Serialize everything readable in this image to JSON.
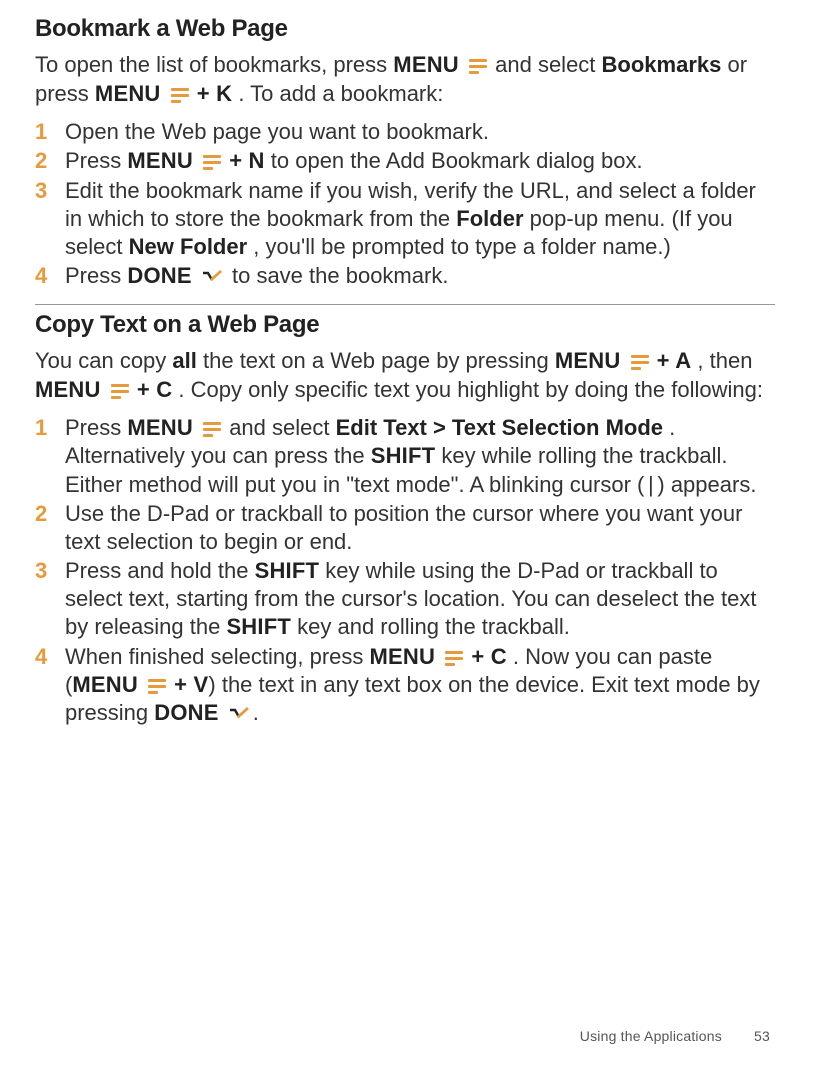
{
  "section1": {
    "heading": "Bookmark a Web Page",
    "intro_parts": {
      "t1": "To open the list of bookmarks, press ",
      "k_menu": "MENU",
      "t2": " and select ",
      "b_bookmarks": "Bookmarks",
      "t3": " or press ",
      "k_menu2": "MENU",
      "t4": " ",
      "k_plusK": "+ K",
      "t5": ". To add a bookmark:"
    },
    "steps": {
      "s1": "Open the Web page you want to bookmark.",
      "s2": {
        "t1": "Press ",
        "k_menu": "MENU",
        "t2": " ",
        "k_plusN": "+ N",
        "t3": " to open the Add Bookmark dialog box."
      },
      "s3": {
        "t1": "Edit the bookmark name if you wish, verify the URL, and select a folder in which to store the bookmark from the ",
        "b_folder": "Folder",
        "t2": " pop-up menu. (If you select ",
        "b_newfolder": "New Folder",
        "t3": ", you'll be prompted to type a folder name.)"
      },
      "s4": {
        "t1": "Press ",
        "k_done": "DONE",
        "t2": " to save the bookmark."
      }
    }
  },
  "section2": {
    "heading": "Copy Text on a Web Page",
    "intro_parts": {
      "t1": "You can copy ",
      "b_all": "all",
      "t2": " the text on a Web page by pressing ",
      "k_menu": "MENU",
      "k_plusA": "+ A",
      "t3": ", then ",
      "k_menu2": "MENU",
      "k_plusC": "+ C",
      "t4": ". Copy only specific text you highlight by doing the following:"
    },
    "steps": {
      "s1": {
        "t1": "Press ",
        "k_menu": "MENU",
        "t2": " and select ",
        "b_edit": "Edit Text > Text Selection Mode",
        "t3": ". Alternatively you can press the ",
        "k_shift": "SHIFT",
        "t4": " key while rolling the trackball. Either method will put you in \"text mode\". A blinking cursor ( | ) appears."
      },
      "s2": "Use the D-Pad or trackball to position the cursor where you want your text selection to begin or end.",
      "s3": {
        "t1": "Press and hold the ",
        "k_shift": "SHIFT",
        "t2": " key while using the D-Pad or trackball to select text, starting from the cursor's location. You can deselect the text by releasing the ",
        "k_shift2": "SHIFT",
        "t3": " key and rolling the trackball."
      },
      "s4": {
        "t1": "When finished selecting, press ",
        "k_menu": "MENU",
        "k_plusC": "+ C",
        "t2": ". Now you can paste (",
        "k_menu2": "MENU",
        "k_plusV": "+ V",
        "t3": ") the text in any text box on the device. Exit text mode by pressing ",
        "k_done": "DONE",
        "t4": "."
      }
    }
  },
  "footer": {
    "label": "Using the Applications",
    "page": "53"
  }
}
